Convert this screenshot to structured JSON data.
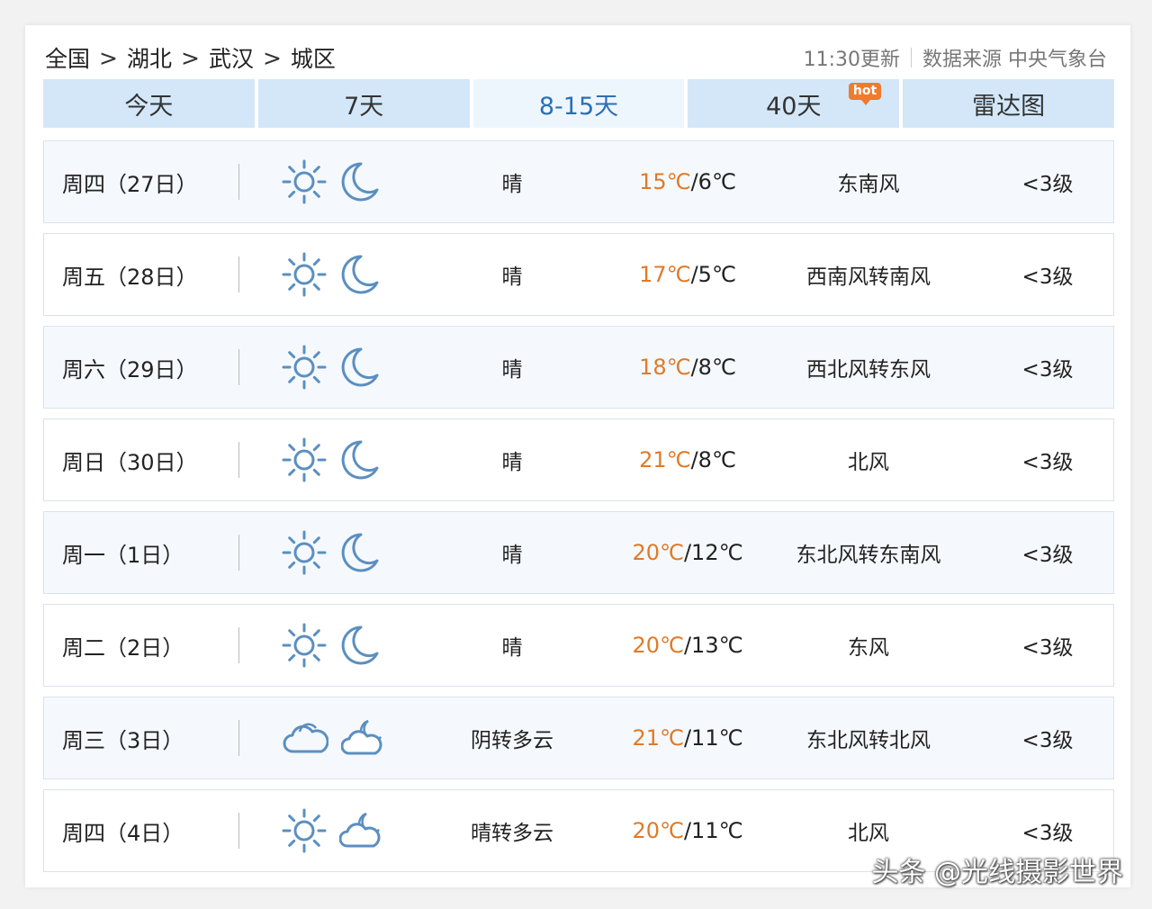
{
  "breadcrumb": [
    "全国",
    "湖北",
    "武汉",
    "城区"
  ],
  "breadcrumb_sep": ">",
  "meta": {
    "update": "11:30更新",
    "source": "数据来源 中央气象台"
  },
  "tabs": [
    {
      "label": "今天"
    },
    {
      "label": "7天"
    },
    {
      "label": "8-15天"
    },
    {
      "label": "40天",
      "badge": "hot"
    },
    {
      "label": "雷达图"
    }
  ],
  "active_tab": 2,
  "colors": {
    "accent": "#2a6fb8",
    "high_temp": "#e07a28",
    "tab_bg": "#d3e7f8",
    "icon": "#5b8fc0"
  },
  "rows": [
    {
      "day": "周四（27日）",
      "day_icon": "sun-icon",
      "night_icon": "moon-icon",
      "desc": "晴",
      "high": "15℃",
      "low": "6℃",
      "wind": "东南风",
      "level": "<3级"
    },
    {
      "day": "周五（28日）",
      "day_icon": "sun-icon",
      "night_icon": "moon-icon",
      "desc": "晴",
      "high": "17℃",
      "low": "5℃",
      "wind": "西南风转南风",
      "level": "<3级"
    },
    {
      "day": "周六（29日）",
      "day_icon": "sun-icon",
      "night_icon": "moon-icon",
      "desc": "晴",
      "high": "18℃",
      "low": "8℃",
      "wind": "西北风转东风",
      "level": "<3级"
    },
    {
      "day": "周日（30日）",
      "day_icon": "sun-icon",
      "night_icon": "moon-icon",
      "desc": "晴",
      "high": "21℃",
      "low": "8℃",
      "wind": "北风",
      "level": "<3级"
    },
    {
      "day": "周一（1日）",
      "day_icon": "sun-icon",
      "night_icon": "moon-icon",
      "desc": "晴",
      "high": "20℃",
      "low": "12℃",
      "wind": "东北风转东南风",
      "level": "<3级"
    },
    {
      "day": "周二（2日）",
      "day_icon": "sun-icon",
      "night_icon": "moon-icon",
      "desc": "晴",
      "high": "20℃",
      "low": "13℃",
      "wind": "东风",
      "level": "<3级"
    },
    {
      "day": "周三（3日）",
      "day_icon": "cloud-icon",
      "night_icon": "cloud-moon-icon",
      "desc": "阴转多云",
      "high": "21℃",
      "low": "11℃",
      "wind": "东北风转北风",
      "level": "<3级"
    },
    {
      "day": "周四（4日）",
      "day_icon": "sun-icon",
      "night_icon": "cloud-moon-icon",
      "desc": "晴转多云",
      "high": "20℃",
      "low": "11℃",
      "wind": "北风",
      "level": "<3级"
    }
  ],
  "watermark": "头条 @光线摄影世界"
}
